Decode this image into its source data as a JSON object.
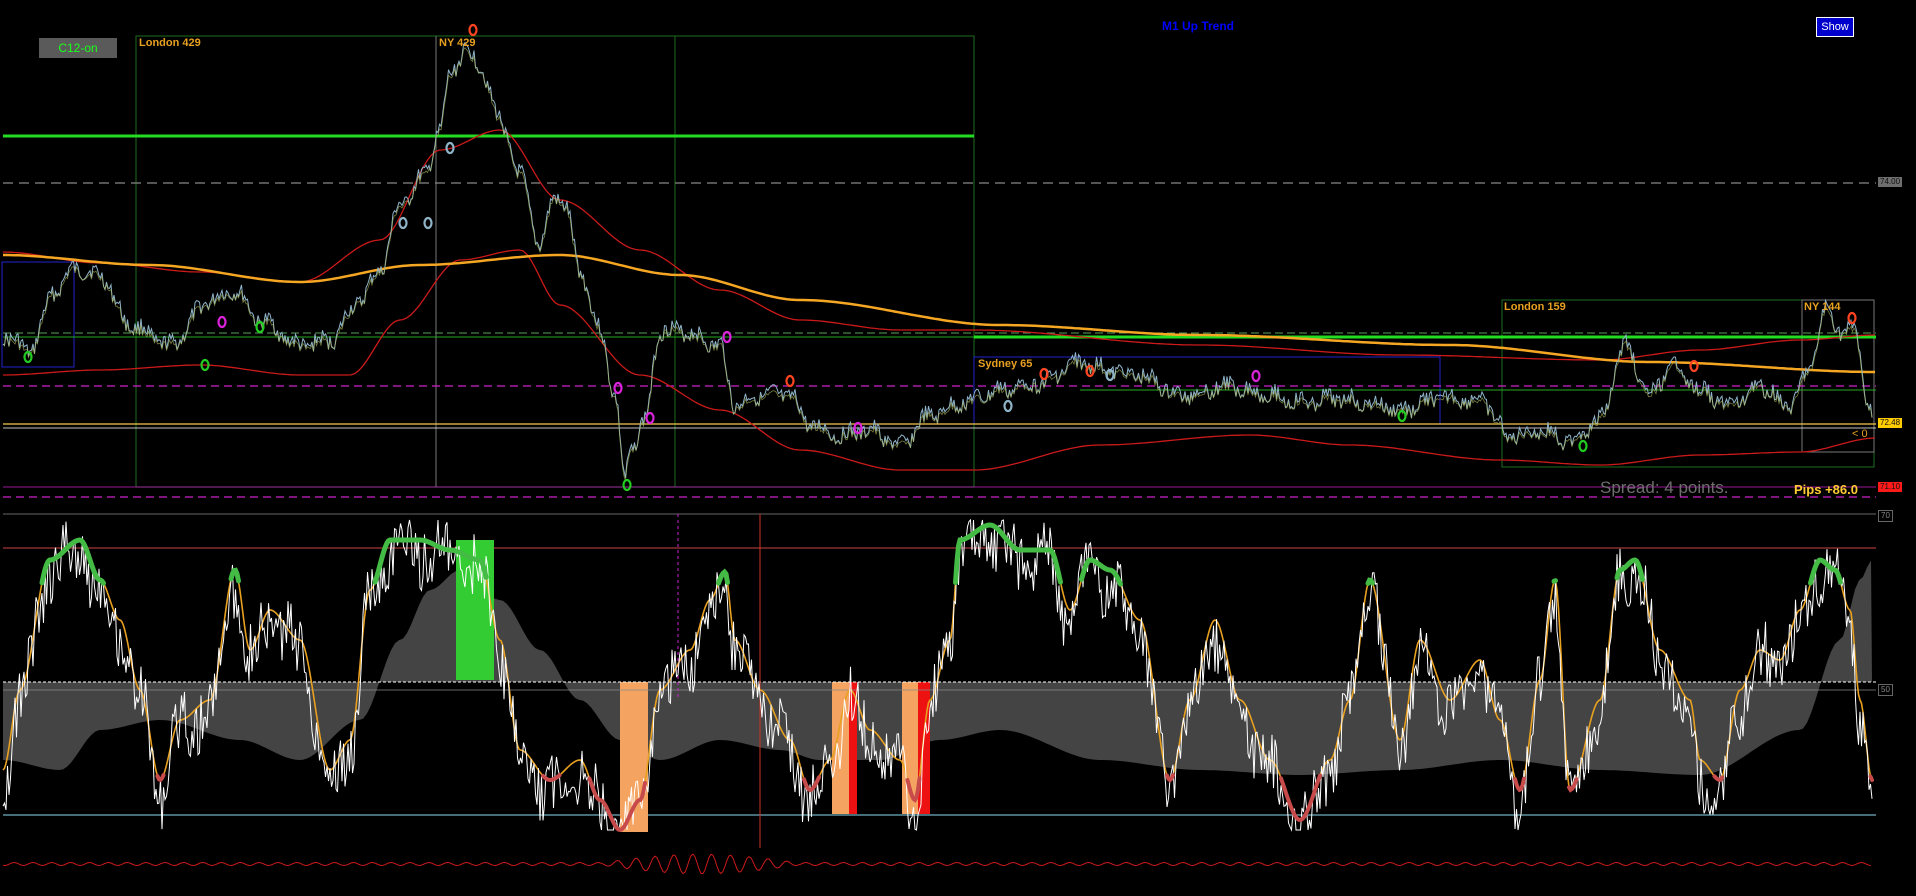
{
  "toolbar": {
    "c12_label": "C12-on",
    "show_label": "Show"
  },
  "header": {
    "trend_label": "M1 Up Trend"
  },
  "sessions": {
    "london_1": "London 429",
    "ny_1": "NY 429",
    "sydney": "Sydney 65",
    "london_2": "London 159",
    "ny_2": "NY 144"
  },
  "info": {
    "spread": "Spread: 4 points.",
    "pips": "Pips +86.0",
    "right_marker": "< 0"
  },
  "price_scale": {
    "level_upper": "74.00",
    "level_lower": "71.10",
    "current_price": "72.48"
  },
  "oscillator_scale": {
    "top": "70",
    "mid": "50"
  },
  "colors": {
    "background": "#000000",
    "price_line": "#8fb4c8",
    "slow_ma": "#f5a623",
    "envelope": "#cc1a1a",
    "level_green": "#22dd22",
    "osc_orange": "#e8a020",
    "osc_white": "#ffffff",
    "osc_band": "#444444",
    "overbought": "#44bb44",
    "oversold": "#c84b4b"
  },
  "icons": {
    "signal_up": "green-up-arrow-icon",
    "signal_down": "red-down-arrow-icon",
    "signal_neutral": "magenta-diamond-icon"
  }
}
